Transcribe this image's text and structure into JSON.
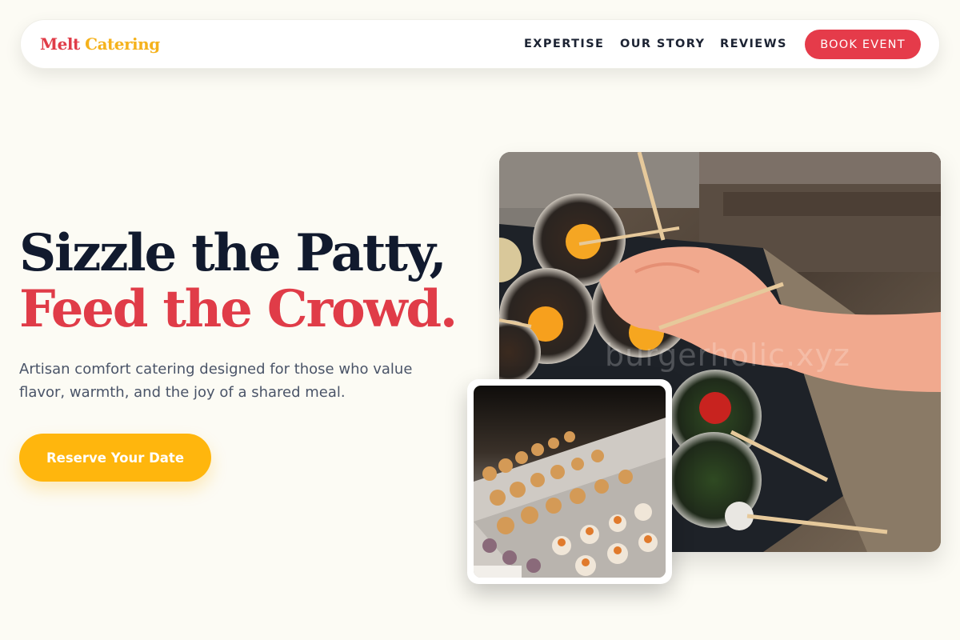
{
  "brand": {
    "part1": "Melt",
    "part2": "Catering"
  },
  "nav": {
    "links": [
      "EXPERTISE",
      "OUR STORY",
      "REVIEWS"
    ],
    "cta_label": "BOOK EVENT"
  },
  "hero": {
    "headline_line1": "Sizzle the Patty,",
    "headline_line2": "Feed the Crowd.",
    "subtext": "Artisan comfort catering designed for those who value flavor, warmth, and the joy of a shared meal.",
    "cta_label": "Reserve Your Date"
  },
  "images": {
    "main": {
      "subject": "appetizer-cups-photo",
      "watermark": "burgerholic.xyz"
    },
    "secondary": {
      "subject": "canape-buffet-photo"
    }
  },
  "colors": {
    "background": "#fcfbf4",
    "brand_red": "#e53b4a",
    "brand_yellow": "#ffb60d",
    "headline_dark": "#111a2e",
    "body_text": "#4a5468"
  }
}
